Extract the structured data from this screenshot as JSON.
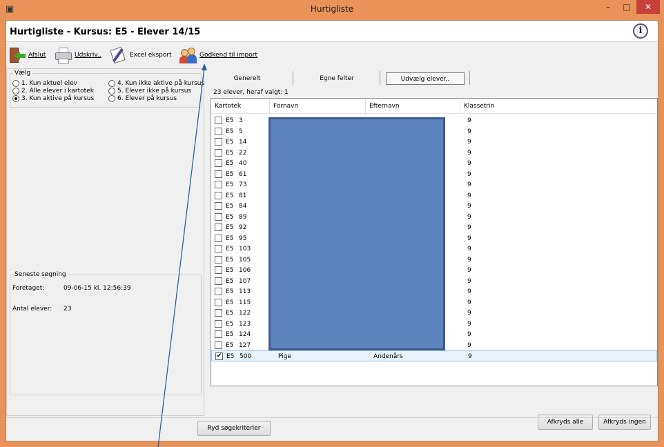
{
  "window": {
    "title": "Hurtigliste",
    "controls": {
      "minimize": "–",
      "maximize": "□",
      "close": "✕"
    }
  },
  "header": {
    "heading": "Hurtigliste - Kursus: E5 - Elever 14/15",
    "info_icon": "i"
  },
  "toolbar": {
    "exit_label": "Afslut",
    "print_label": "Udskriv..",
    "excel_label": "Excel eksport",
    "import_label": "Godkend til import"
  },
  "filter": {
    "legend": "Vælg",
    "options": [
      {
        "label": "1. Kun aktuel elev",
        "selected": false
      },
      {
        "label": "2. Alle elever i kartotek",
        "selected": false
      },
      {
        "label": "3. Kun aktive på kursus",
        "selected": true
      },
      {
        "label": "4. Kun ikke aktive på kursus",
        "selected": false
      },
      {
        "label": "5. Elever ikke på kursus",
        "selected": false
      },
      {
        "label": "6. Elever på kursus",
        "selected": false
      }
    ]
  },
  "last_search": {
    "legend": "Seneste søgning",
    "performed_label": "Foretaget:",
    "performed_value": "09-06-15 kl. 12:56:39",
    "count_label": "Antal elever:",
    "count_value": "23"
  },
  "tabs": {
    "general": "Generelt",
    "custom": "Egne felter",
    "select": "Udvælg elever.."
  },
  "list": {
    "summary": "23 elever, heraf valgt: 1",
    "columns": [
      "Kartotek",
      "Fornavn",
      "Efternavn",
      "Klassetrin"
    ],
    "rows": [
      {
        "kartotek": "E5",
        "nr": "3",
        "fornavn": "",
        "efternavn": "",
        "klassetrin": "9",
        "checked": false
      },
      {
        "kartotek": "E5",
        "nr": "5",
        "fornavn": "",
        "efternavn": "",
        "klassetrin": "9",
        "checked": false
      },
      {
        "kartotek": "E5",
        "nr": "14",
        "fornavn": "",
        "efternavn": "",
        "klassetrin": "9",
        "checked": false
      },
      {
        "kartotek": "E5",
        "nr": "22",
        "fornavn": "",
        "efternavn": "",
        "klassetrin": "9",
        "checked": false
      },
      {
        "kartotek": "E5",
        "nr": "40",
        "fornavn": "",
        "efternavn": "",
        "klassetrin": "9",
        "checked": false
      },
      {
        "kartotek": "E5",
        "nr": "61",
        "fornavn": "",
        "efternavn": "",
        "klassetrin": "9",
        "checked": false
      },
      {
        "kartotek": "E5",
        "nr": "73",
        "fornavn": "",
        "efternavn": "",
        "klassetrin": "9",
        "checked": false
      },
      {
        "kartotek": "E5",
        "nr": "81",
        "fornavn": "",
        "efternavn": "",
        "klassetrin": "9",
        "checked": false
      },
      {
        "kartotek": "E5",
        "nr": "84",
        "fornavn": "",
        "efternavn": "",
        "klassetrin": "9",
        "checked": false
      },
      {
        "kartotek": "E5",
        "nr": "89",
        "fornavn": "",
        "efternavn": "",
        "klassetrin": "9",
        "checked": false
      },
      {
        "kartotek": "E5",
        "nr": "92",
        "fornavn": "",
        "efternavn": "",
        "klassetrin": "9",
        "checked": false
      },
      {
        "kartotek": "E5",
        "nr": "95",
        "fornavn": "",
        "efternavn": "",
        "klassetrin": "9",
        "checked": false
      },
      {
        "kartotek": "E5",
        "nr": "103",
        "fornavn": "",
        "efternavn": "",
        "klassetrin": "9",
        "checked": false
      },
      {
        "kartotek": "E5",
        "nr": "105",
        "fornavn": "",
        "efternavn": "",
        "klassetrin": "9",
        "checked": false
      },
      {
        "kartotek": "E5",
        "nr": "106",
        "fornavn": "",
        "efternavn": "",
        "klassetrin": "9",
        "checked": false
      },
      {
        "kartotek": "E5",
        "nr": "107",
        "fornavn": "",
        "efternavn": "",
        "klassetrin": "9",
        "checked": false
      },
      {
        "kartotek": "E5",
        "nr": "113",
        "fornavn": "",
        "efternavn": "",
        "klassetrin": "9",
        "checked": false
      },
      {
        "kartotek": "E5",
        "nr": "115",
        "fornavn": "",
        "efternavn": "",
        "klassetrin": "9",
        "checked": false
      },
      {
        "kartotek": "E5",
        "nr": "122",
        "fornavn": "",
        "efternavn": "",
        "klassetrin": "9",
        "checked": false
      },
      {
        "kartotek": "E5",
        "nr": "123",
        "fornavn": "",
        "efternavn": "",
        "klassetrin": "9",
        "checked": false
      },
      {
        "kartotek": "E5",
        "nr": "124",
        "fornavn": "",
        "efternavn": "",
        "klassetrin": "9",
        "checked": false
      },
      {
        "kartotek": "E5",
        "nr": "127",
        "fornavn": "",
        "efternavn": "",
        "klassetrin": "9",
        "checked": false
      },
      {
        "kartotek": "E5",
        "nr": "500",
        "fornavn": "Pige",
        "efternavn": "Andenårs",
        "klassetrin": "9",
        "checked": true
      }
    ]
  },
  "buttons": {
    "check_all": "Afkryds alle",
    "check_none": "Afkryds ingen",
    "clear_criteria": "Ryd søgekriterier"
  },
  "icons": {
    "app": "app-icon",
    "exit": "exit-door-icon",
    "print": "printer-icon",
    "excel": "excel-export-icon",
    "import": "people-import-icon",
    "info": "info-icon"
  },
  "colors": {
    "window_frame": "#e9935a",
    "close_button": "#c7403a",
    "redaction": "#5c84bd",
    "selected_row": "#e8f2fb"
  }
}
